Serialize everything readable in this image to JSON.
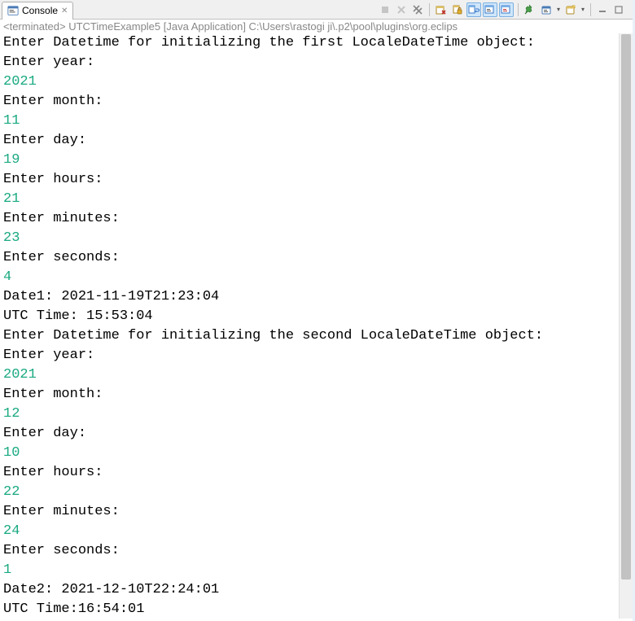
{
  "tab": {
    "title": "Console",
    "close": "✕"
  },
  "toolbar": {
    "dropdown_arrow": "▾"
  },
  "status": "<terminated> UTCTimeExample5 [Java Application] C:\\Users\\rastogi ji\\.p2\\pool\\plugins\\org.eclips",
  "lines": [
    {
      "text": "Enter Datetime for initializing the first LocaleDateTime object:",
      "cls": ""
    },
    {
      "text": "Enter year:",
      "cls": ""
    },
    {
      "text": "2021",
      "cls": "in"
    },
    {
      "text": "Enter month:",
      "cls": ""
    },
    {
      "text": "11",
      "cls": "in"
    },
    {
      "text": "Enter day:",
      "cls": ""
    },
    {
      "text": "19",
      "cls": "in"
    },
    {
      "text": "Enter hours:",
      "cls": ""
    },
    {
      "text": "21",
      "cls": "in"
    },
    {
      "text": "Enter minutes:",
      "cls": ""
    },
    {
      "text": "23",
      "cls": "in"
    },
    {
      "text": "Enter seconds:",
      "cls": ""
    },
    {
      "text": "4",
      "cls": "in"
    },
    {
      "text": "Date1: 2021-11-19T21:23:04",
      "cls": ""
    },
    {
      "text": "UTC Time: 15:53:04",
      "cls": ""
    },
    {
      "text": "Enter Datetime for initializing the second LocaleDateTime object:",
      "cls": ""
    },
    {
      "text": "Enter year:",
      "cls": ""
    },
    {
      "text": "2021",
      "cls": "in"
    },
    {
      "text": "Enter month:",
      "cls": ""
    },
    {
      "text": "12",
      "cls": "in"
    },
    {
      "text": "Enter day:",
      "cls": ""
    },
    {
      "text": "10",
      "cls": "in"
    },
    {
      "text": "Enter hours:",
      "cls": ""
    },
    {
      "text": "22",
      "cls": "in"
    },
    {
      "text": "Enter minutes:",
      "cls": ""
    },
    {
      "text": "24",
      "cls": "in"
    },
    {
      "text": "Enter seconds:",
      "cls": ""
    },
    {
      "text": "1",
      "cls": "in"
    },
    {
      "text": "Date2: 2021-12-10T22:24:01",
      "cls": ""
    },
    {
      "text": "UTC Time:16:54:01",
      "cls": ""
    }
  ]
}
